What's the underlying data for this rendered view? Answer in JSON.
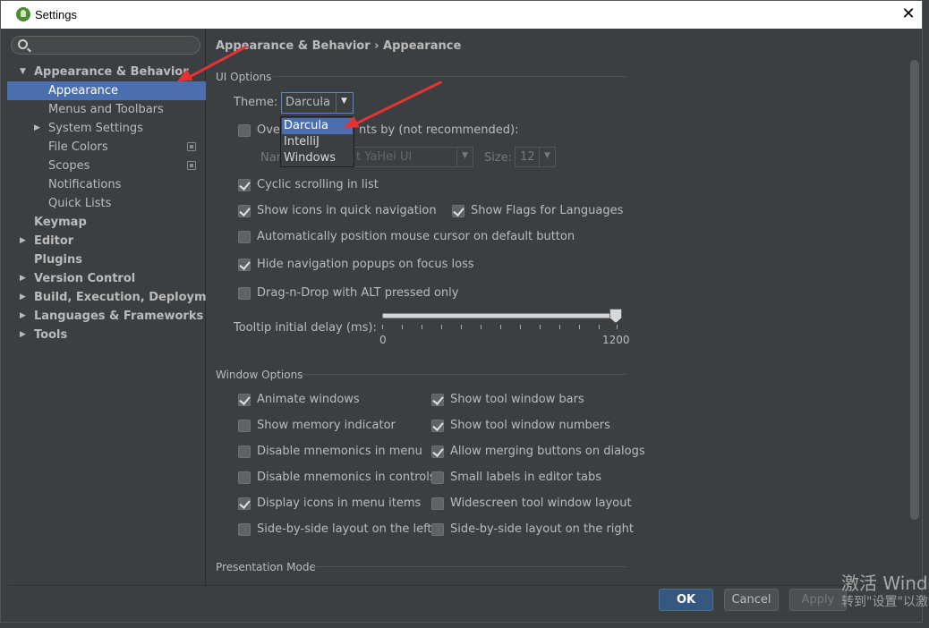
{
  "window": {
    "title": "Settings",
    "close_glyph": "✕"
  },
  "search": {
    "placeholder": "",
    "value": ""
  },
  "sidebar": {
    "items": [
      {
        "label": "Appearance & Behavior",
        "arrow": "▼"
      },
      {
        "label": "Appearance"
      },
      {
        "label": "Menus and Toolbars"
      },
      {
        "label": "System Settings",
        "arrow": "▶"
      },
      {
        "label": "File Colors"
      },
      {
        "label": "Scopes"
      },
      {
        "label": "Notifications"
      },
      {
        "label": "Quick Lists"
      },
      {
        "label": "Keymap"
      },
      {
        "label": "Editor",
        "arrow": "▶"
      },
      {
        "label": "Plugins"
      },
      {
        "label": "Version Control",
        "arrow": "▶"
      },
      {
        "label": "Build, Execution, Deployment",
        "arrow": "▶"
      },
      {
        "label": "Languages & Frameworks",
        "arrow": "▶"
      },
      {
        "label": "Tools",
        "arrow": "▶"
      }
    ]
  },
  "content": {
    "breadcrumb": "Appearance & Behavior › Appearance",
    "ui_options": {
      "title": "UI Options",
      "theme_label": "Theme:",
      "theme_value": "Darcula",
      "theme_options": [
        "Darcula",
        "IntelliJ",
        "Windows"
      ],
      "override_label": "Override default fonts by (not recommended):",
      "override_visible_suffix": "nts by (not recommended):",
      "override_visible_prefix": "Over",
      "name_label": "Name:",
      "name_visible": "Nar",
      "font_value": "t YaHei UI",
      "size_label": "Size:",
      "size_value": "12",
      "cyclic_scrolling": "Cyclic scrolling in list",
      "show_icons_nav": "Show icons in quick navigation",
      "show_flags": "Show Flags for Languages",
      "auto_position": "Automatically position mouse cursor on default button",
      "hide_nav_popups": "Hide navigation popups on focus loss",
      "drag_drop_alt": "Drag-n-Drop with ALT pressed only",
      "tooltip_label": "Tooltip initial delay (ms):",
      "tooltip_min": "0",
      "tooltip_max": "1200",
      "tooltip_value": 1200
    },
    "window_options": {
      "title": "Window Options",
      "animate_windows": "Animate windows",
      "show_memory": "Show memory indicator",
      "disable_mnemonics_menu": "Disable mnemonics in menu",
      "disable_mnemonics_controls": "Disable mnemonics in controls",
      "display_icons_menu": "Display icons in menu items",
      "side_by_side_left": "Side-by-side layout on the left",
      "show_tool_window_bars": "Show tool window bars",
      "show_tool_window_numbers": "Show tool window numbers",
      "allow_merging_buttons": "Allow merging buttons on dialogs",
      "small_labels_tabs": "Small labels in editor tabs",
      "widescreen_layout": "Widescreen tool window layout",
      "side_by_side_right": "Side-by-side layout on the right"
    },
    "presentation_mode": {
      "title": "Presentation Mode"
    }
  },
  "footer": {
    "ok": "OK",
    "cancel": "Cancel",
    "apply": "Apply"
  },
  "watermark": {
    "line1": "激活 Windo",
    "line2": "转到\"设置\"以激"
  },
  "colors": {
    "selection": "#4b6eaf",
    "annotation_arrow": "#e53333",
    "ok_button": "#365880"
  }
}
